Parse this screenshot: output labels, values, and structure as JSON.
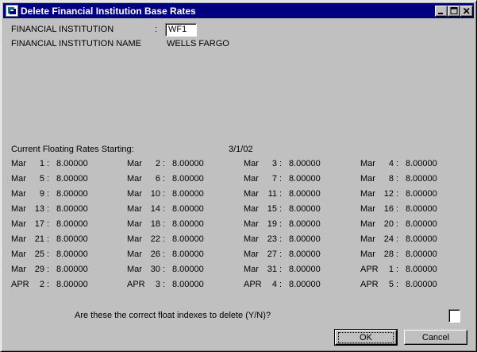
{
  "window": {
    "title": "Delete Financial Institution Base Rates",
    "colors": {
      "titlebar": "#000080",
      "face": "#c0c0c0"
    }
  },
  "form": {
    "institution_label": "FINANCIAL INSTITUTION",
    "institution_colon": ":",
    "institution_value": "WF1",
    "institution_name_label": "FINANCIAL INSTITUTION NAME",
    "institution_name_value": "WELLS FARGO"
  },
  "rates": {
    "heading": "Current Floating Rates Starting:",
    "start_date": "3/1/02",
    "entries": [
      {
        "month": "Mar",
        "day": "1",
        "rate": "8.00000"
      },
      {
        "month": "Mar",
        "day": "2",
        "rate": "8.00000"
      },
      {
        "month": "Mar",
        "day": "3",
        "rate": "8.00000"
      },
      {
        "month": "Mar",
        "day": "4",
        "rate": "8.00000"
      },
      {
        "month": "Mar",
        "day": "5",
        "rate": "8.00000"
      },
      {
        "month": "Mar",
        "day": "6",
        "rate": "8.00000"
      },
      {
        "month": "Mar",
        "day": "7",
        "rate": "8.00000"
      },
      {
        "month": "Mar",
        "day": "8",
        "rate": "8.00000"
      },
      {
        "month": "Mar",
        "day": "9",
        "rate": "8.00000"
      },
      {
        "month": "Mar",
        "day": "10",
        "rate": "8.00000"
      },
      {
        "month": "Mar",
        "day": "11",
        "rate": "8.00000"
      },
      {
        "month": "Mar",
        "day": "12",
        "rate": "8.00000"
      },
      {
        "month": "Mar",
        "day": "13",
        "rate": "8.00000"
      },
      {
        "month": "Mar",
        "day": "14",
        "rate": "8.00000"
      },
      {
        "month": "Mar",
        "day": "15",
        "rate": "8.00000"
      },
      {
        "month": "Mar",
        "day": "16",
        "rate": "8.00000"
      },
      {
        "month": "Mar",
        "day": "17",
        "rate": "8.00000"
      },
      {
        "month": "Mar",
        "day": "18",
        "rate": "8.00000"
      },
      {
        "month": "Mar",
        "day": "19",
        "rate": "8.00000"
      },
      {
        "month": "Mar",
        "day": "20",
        "rate": "8.00000"
      },
      {
        "month": "Mar",
        "day": "21",
        "rate": "8.00000"
      },
      {
        "month": "Mar",
        "day": "22",
        "rate": "8.00000"
      },
      {
        "month": "Mar",
        "day": "23",
        "rate": "8.00000"
      },
      {
        "month": "Mar",
        "day": "24",
        "rate": "8.00000"
      },
      {
        "month": "Mar",
        "day": "25",
        "rate": "8.00000"
      },
      {
        "month": "Mar",
        "day": "26",
        "rate": "8.00000"
      },
      {
        "month": "Mar",
        "day": "27",
        "rate": "8.00000"
      },
      {
        "month": "Mar",
        "day": "28",
        "rate": "8.00000"
      },
      {
        "month": "Mar",
        "day": "29",
        "rate": "8.00000"
      },
      {
        "month": "Mar",
        "day": "30",
        "rate": "8.00000"
      },
      {
        "month": "Mar",
        "day": "31",
        "rate": "8.00000"
      },
      {
        "month": "APR",
        "day": "1",
        "rate": "8.00000"
      },
      {
        "month": "APR",
        "day": "2",
        "rate": "8.00000"
      },
      {
        "month": "APR",
        "day": "3",
        "rate": "8.00000"
      },
      {
        "month": "APR",
        "day": "4",
        "rate": "8.00000"
      },
      {
        "month": "APR",
        "day": "5",
        "rate": "8.00000"
      }
    ]
  },
  "confirm": {
    "question": "Are these the correct float indexes to delete (Y/N)?",
    "answer": ""
  },
  "buttons": {
    "ok_label": "OK",
    "cancel_label": "Cancel"
  }
}
